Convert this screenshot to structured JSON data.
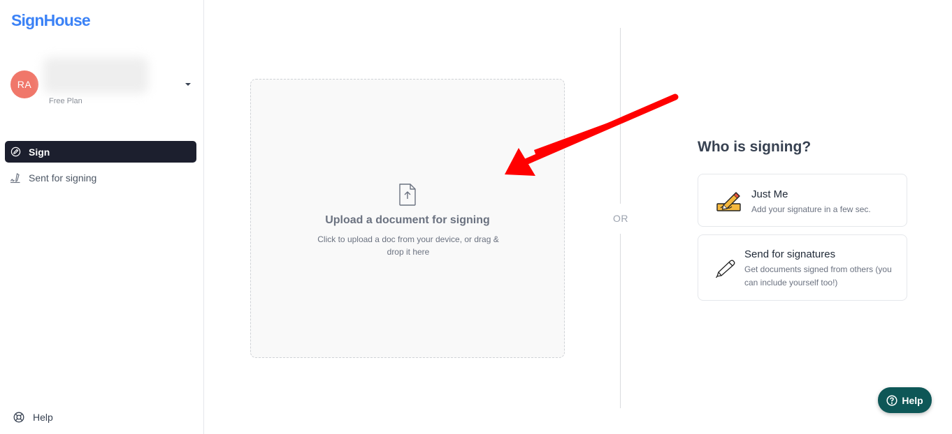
{
  "sidebar": {
    "logo": "SignHouse",
    "user": {
      "initials": "RA",
      "plan": "Free Plan"
    },
    "nav": [
      {
        "label": "Sign",
        "icon": "pen-circle-icon",
        "active": true
      },
      {
        "label": "Sent for signing",
        "icon": "signature-icon",
        "active": false
      }
    ],
    "help_label": "Help"
  },
  "upload": {
    "icon": "file-upload-icon",
    "title": "Upload a document for signing",
    "subtitle": "Click to upload a doc from your device, or drag & drop it here"
  },
  "divider_label": "OR",
  "who": {
    "title": "Who is signing?",
    "options": [
      {
        "title": "Just Me",
        "desc": "Add your signature in a few sec.",
        "icon": "writing-hand-icon"
      },
      {
        "title": "Send for signatures",
        "desc": "Get documents signed from others (you can include yourself too!)",
        "icon": "pen-icon"
      }
    ]
  },
  "help_button": {
    "label": "Help",
    "icon": "question-circle-icon"
  },
  "colors": {
    "brand": "#3b82f6",
    "nav_active_bg": "#1c1f2e",
    "avatar": "#f0776a",
    "help_button": "#0e5757",
    "annotation_arrow": "#ff0000"
  }
}
